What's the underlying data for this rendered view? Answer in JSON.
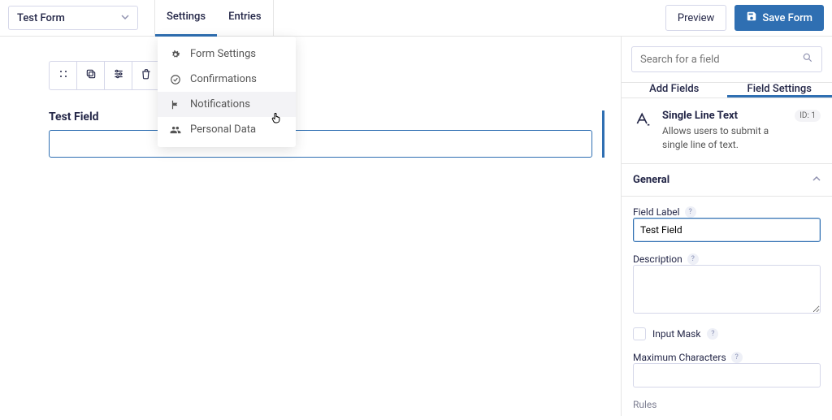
{
  "header": {
    "form_name": "Test Form",
    "tabs": {
      "settings": "Settings",
      "entries": "Entries"
    },
    "preview": "Preview",
    "save": "Save Form"
  },
  "dropdown": {
    "form_settings": "Form Settings",
    "confirmations": "Confirmations",
    "notifications": "Notifications",
    "personal_data": "Personal Data"
  },
  "canvas": {
    "field_label": "Test Field"
  },
  "sidebar": {
    "search_placeholder": "Search for a field",
    "tabs": {
      "add": "Add Fields",
      "settings": "Field Settings"
    },
    "field_type": {
      "title": "Single Line Text",
      "desc": "Allows users to submit a single line of text.",
      "id": "ID: 1"
    },
    "general": {
      "title": "General",
      "field_label_lbl": "Field Label",
      "field_label_value": "Test Field",
      "description_lbl": "Description",
      "input_mask_lbl": "Input Mask",
      "max_chars_lbl": "Maximum Characters",
      "rules_lbl": "Rules"
    }
  }
}
